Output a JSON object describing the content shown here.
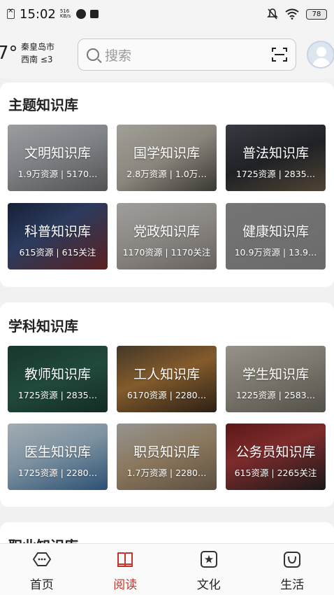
{
  "status_bar": {
    "time": "15:02",
    "net_speed_value": "516",
    "net_speed_unit": "KB/s",
    "battery": "78"
  },
  "header": {
    "temperature": "7°",
    "city": "秦皇岛市",
    "wind": "西南  ≤3",
    "search_placeholder": "搜索"
  },
  "sections": [
    {
      "title": "主题知识库",
      "cards": [
        {
          "name": "文明知识库",
          "stats": "1.9万资源 | 5170…"
        },
        {
          "name": "国学知识库",
          "stats": "2.8万资源 | 1.0万…"
        },
        {
          "name": "普法知识库",
          "stats": "1725资源 | 2835…"
        },
        {
          "name": "科普知识库",
          "stats": "615资源 | 615关注"
        },
        {
          "name": "党政知识库",
          "stats": "1170资源 | 1170关注"
        },
        {
          "name": "健康知识库",
          "stats": "10.9万资源 | 13.9…"
        }
      ]
    },
    {
      "title": "学科知识库",
      "cards": [
        {
          "name": "教师知识库",
          "stats": "1725资源 | 2835…"
        },
        {
          "name": "工人知识库",
          "stats": "6170资源 | 2280…"
        },
        {
          "name": "学生知识库",
          "stats": "1225资源 | 2583…"
        },
        {
          "name": "医生知识库",
          "stats": "1725资源 | 2280…"
        },
        {
          "name": "职员知识库",
          "stats": "1.7万资源 | 2280…"
        },
        {
          "name": "公务员知识库",
          "stats": "615资源 | 2265关注"
        }
      ]
    },
    {
      "title": "职业知识库"
    }
  ],
  "bottom_nav": [
    {
      "label": "首页",
      "icon": "home-icon"
    },
    {
      "label": "阅读",
      "icon": "book-icon",
      "active": true
    },
    {
      "label": "文化",
      "icon": "culture-icon"
    },
    {
      "label": "生活",
      "icon": "life-icon"
    }
  ],
  "colors": {
    "accent": "#c6332b",
    "background": "#f1f1f1"
  }
}
